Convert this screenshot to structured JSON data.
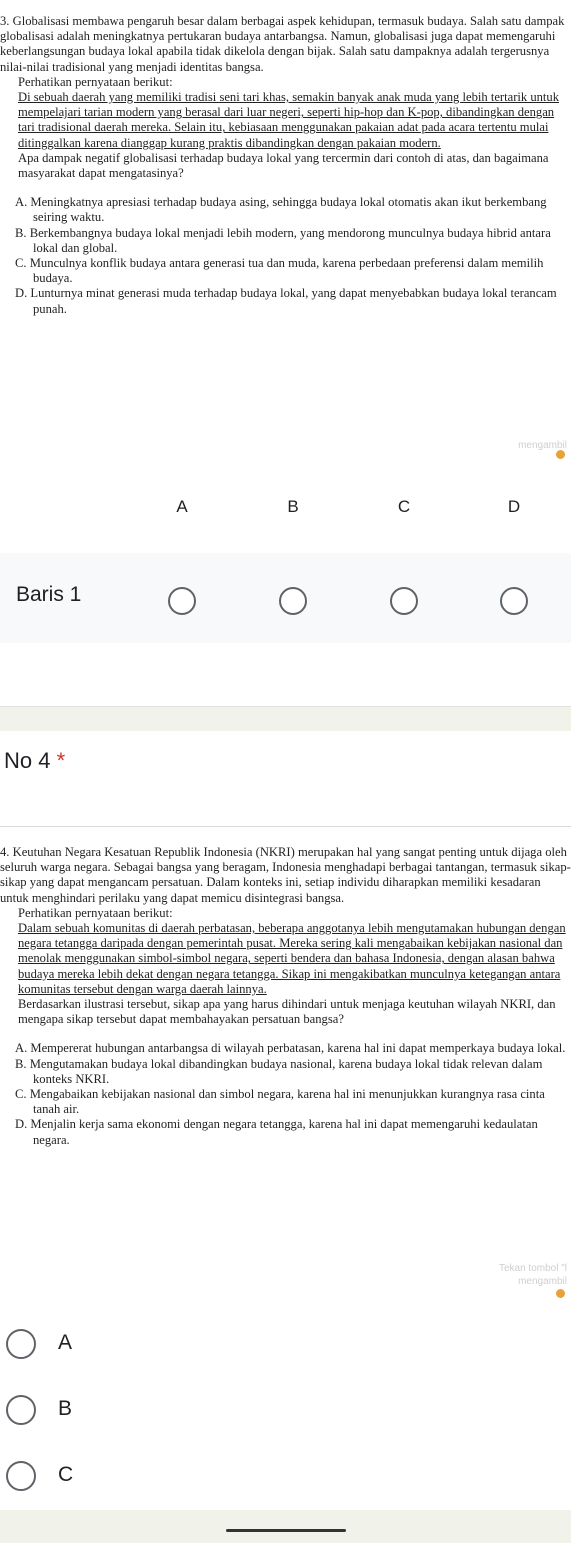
{
  "q3": {
    "intro": "3. Globalisasi membawa pengaruh besar dalam berbagai aspek kehidupan, termasuk budaya. Salah satu dampak globalisasi adalah meningkatnya pertukaran budaya antarbangsa. Namun, globalisasi juga dapat memengaruhi keberlangsungan budaya lokal apabila tidak dikelola dengan bijak. Salah satu dampaknya adalah tergerusnya nilai-nilai tradisional yang menjadi identitas bangsa.",
    "perhatikan": "Perhatikan pernyataan berikut:",
    "statement": "Di sebuah daerah yang memiliki tradisi seni tari khas, semakin banyak anak muda yang lebih tertarik untuk mempelajari tarian modern yang berasal dari luar negeri, seperti hip-hop dan K-pop, dibandingkan dengan tari tradisional daerah mereka. Selain itu, kebiasaan menggunakan pakaian adat pada acara tertentu mulai ditinggalkan karena dianggap kurang praktis dibandingkan dengan pakaian modern.",
    "question": "Apa dampak negatif globalisasi terhadap budaya lokal yang tercermin dari contoh di atas, dan bagaimana masyarakat dapat mengatasinya?",
    "options": [
      "A. Meningkatnya apresiasi terhadap budaya asing, sehingga budaya lokal otomatis akan ikut berkembang seiring waktu.",
      "B. Berkembangnya budaya lokal menjadi lebih modern, yang mendorong munculnya budaya hibrid antara lokal dan global.",
      "C. Munculnya konflik budaya antara generasi tua dan muda, karena perbedaan preferensi dalam memilih budaya.",
      "D. Lunturnya minat generasi muda terhadap budaya lokal, yang dapat menyebabkan budaya lokal terancam punah."
    ],
    "watermark": "mengambil"
  },
  "grid": {
    "columns": [
      "A",
      "B",
      "C",
      "D"
    ],
    "row_label": "Baris 1"
  },
  "question4": {
    "title": "No 4",
    "required_mark": "*"
  },
  "q4": {
    "intro": "4. Keutuhan Negara Kesatuan Republik Indonesia (NKRI) merupakan hal yang sangat penting untuk dijaga oleh seluruh warga negara. Sebagai bangsa yang beragam, Indonesia menghadapi berbagai tantangan, termasuk sikap-sikap yang dapat mengancam persatuan. Dalam konteks ini, setiap individu diharapkan memiliki kesadaran untuk menghindari perilaku yang dapat memicu disintegrasi bangsa.",
    "perhatikan": "Perhatikan pernyataan berikut:",
    "statement": "Dalam sebuah komunitas di daerah perbatasan, beberapa anggotanya lebih mengutamakan hubungan dengan negara tetangga daripada dengan pemerintah pusat. Mereka sering kali mengabaikan kebijakan nasional dan menolak menggunakan simbol-simbol negara, seperti bendera dan bahasa Indonesia, dengan alasan bahwa budaya mereka lebih dekat dengan negara tetangga. Sikap ini mengakibatkan munculnya ketegangan antara komunitas tersebut dengan warga daerah lainnya.",
    "question": "Berdasarkan ilustrasi tersebut, sikap apa yang harus dihindari untuk menjaga keutuhan wilayah NKRI, dan mengapa sikap tersebut dapat membahayakan persatuan bangsa?",
    "options": [
      "A. Mempererat hubungan antarbangsa di wilayah perbatasan, karena hal ini dapat memperkaya budaya lokal.",
      "B. Mengutamakan budaya lokal dibandingkan budaya nasional, karena budaya lokal tidak relevan dalam konteks NKRI.",
      "C. Mengabaikan kebijakan nasional dan simbol negara, karena hal ini menunjukkan kurangnya rasa cinta tanah air.",
      "D. Menjalin kerja sama ekonomi dengan negara tetangga, karena hal ini dapat memengaruhi kedaulatan negara."
    ],
    "watermark_1": "Tekan tombol \"l",
    "watermark_2": "mengambil"
  },
  "choices": [
    "A",
    "B",
    "C"
  ]
}
